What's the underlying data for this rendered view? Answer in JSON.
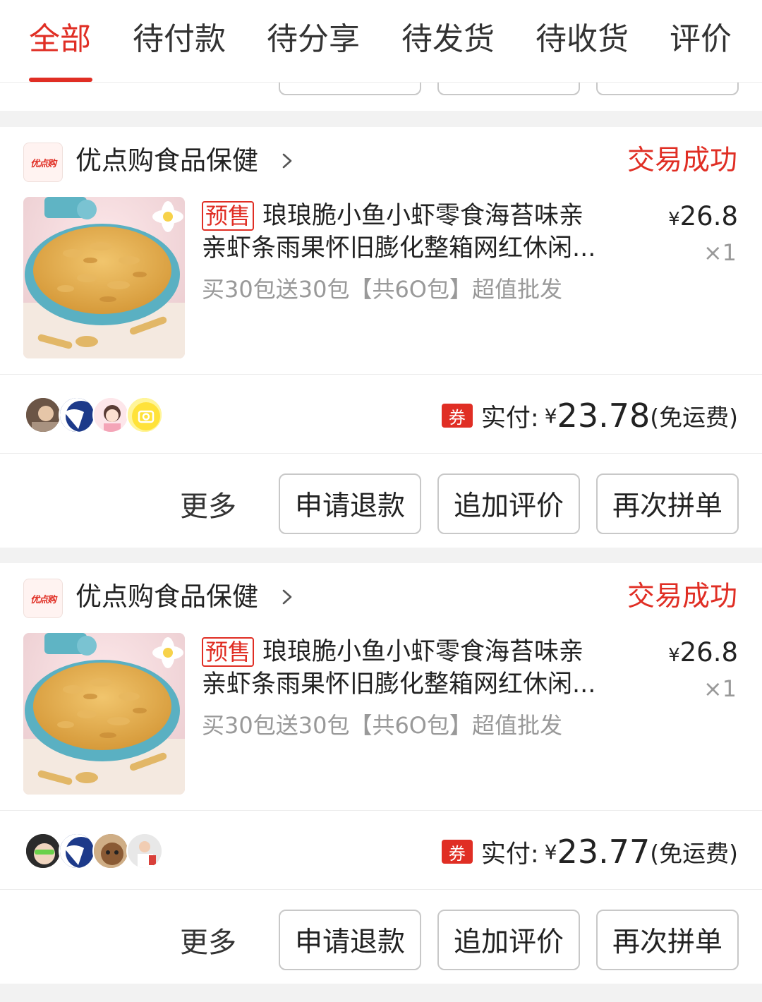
{
  "tabs": [
    {
      "label": "全部",
      "active": true
    },
    {
      "label": "待付款",
      "active": false
    },
    {
      "label": "待分享",
      "active": false
    },
    {
      "label": "待发货",
      "active": false
    },
    {
      "label": "待收货",
      "active": false
    },
    {
      "label": "评价",
      "active": false
    }
  ],
  "colors": {
    "accent": "#e02e24",
    "muted": "#999999"
  },
  "orders": [
    {
      "shop": {
        "logo_text": "优点购",
        "name": "优点购食品保健",
        "chevron": "chevron-right-icon"
      },
      "status": "交易成功",
      "product": {
        "tag": "预售",
        "title_line1": "琅琅脆小鱼小虾零食海苔味亲",
        "title_line2": "亲虾条雨果怀旧膨化整箱网红休闲...",
        "spec": "买30包送30包【共6O包】超值批发",
        "price_symbol": "¥",
        "price": "26.8",
        "quantity": "×1"
      },
      "coupon_label": "券",
      "paid_label": "实付:",
      "paid_symbol": "¥",
      "paid_amount": "23.78",
      "shipping_note": "(免运费)",
      "more_label": "更多",
      "buttons": [
        "申请退款",
        "追加评价",
        "再次拼单"
      ]
    },
    {
      "shop": {
        "logo_text": "优点购",
        "name": "优点购食品保健",
        "chevron": "chevron-right-icon"
      },
      "status": "交易成功",
      "product": {
        "tag": "预售",
        "title_line1": "琅琅脆小鱼小虾零食海苔味亲",
        "title_line2": "亲虾条雨果怀旧膨化整箱网红休闲...",
        "spec": "买30包送30包【共6O包】超值批发",
        "price_symbol": "¥",
        "price": "26.8",
        "quantity": "×1"
      },
      "coupon_label": "券",
      "paid_label": "实付:",
      "paid_symbol": "¥",
      "paid_amount": "23.77",
      "shipping_note": "(免运费)",
      "more_label": "更多",
      "buttons": [
        "申请退款",
        "追加评价",
        "再次拼单"
      ]
    }
  ]
}
